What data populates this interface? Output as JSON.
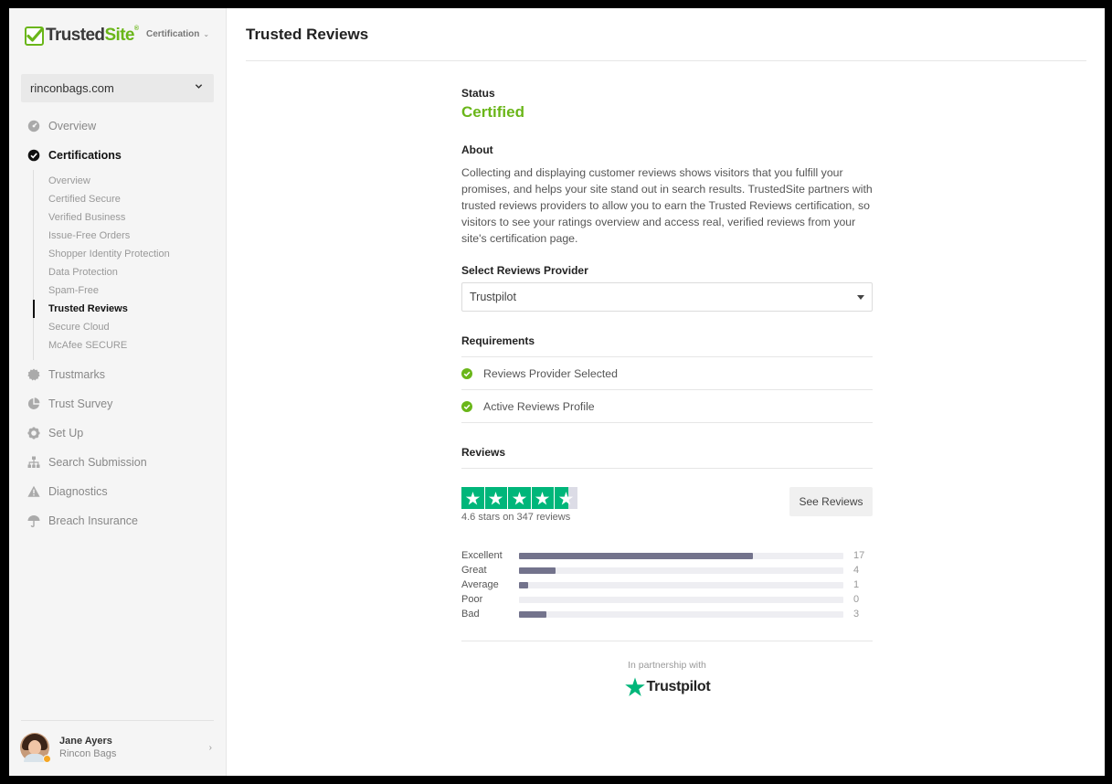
{
  "brand": {
    "name_part1": "Trusted",
    "name_part2": "Site",
    "reg": "®"
  },
  "header_switch": {
    "label": "Certification"
  },
  "site_selector": {
    "value": "rinconbags.com"
  },
  "nav": {
    "overview": "Overview",
    "certifications": "Certifications",
    "sub_items": [
      "Overview",
      "Certified Secure",
      "Verified Business",
      "Issue-Free Orders",
      "Shopper Identity Protection",
      "Data Protection",
      "Spam-Free",
      "Trusted Reviews",
      "Secure Cloud",
      "McAfee SECURE"
    ],
    "active_sub": "Trusted Reviews",
    "trustmarks": "Trustmarks",
    "trust_survey": "Trust Survey",
    "set_up": "Set Up",
    "search_submission": "Search Submission",
    "diagnostics": "Diagnostics",
    "breach_insurance": "Breach Insurance"
  },
  "user": {
    "name": "Jane Ayers",
    "company": "Rincon Bags"
  },
  "page": {
    "title": "Trusted Reviews",
    "status_label": "Status",
    "status_value": "Certified",
    "about_label": "About",
    "about_text": "Collecting and displaying customer reviews shows visitors that you fulfill your promises, and helps your site stand out in search results. TrustedSite partners with trusted reviews providers to allow you to earn the Trusted Reviews certification, so visitors to see your ratings overview and access real, verified reviews from your site's certification page.",
    "provider_label": "Select Reviews Provider",
    "provider_value": "Trustpilot",
    "requirements_label": "Requirements",
    "requirements": [
      "Reviews Provider Selected",
      "Active Reviews Profile"
    ],
    "reviews_label": "Reviews",
    "rating": 4.6,
    "rating_caption": "4.6 stars on 347 reviews",
    "see_reviews_button": "See Reviews",
    "distribution": [
      {
        "label": "Excellent",
        "count": "17",
        "fraction": 0.72
      },
      {
        "label": "Great",
        "count": "4",
        "fraction": 0.113
      },
      {
        "label": "Average",
        "count": "1",
        "fraction": 0.028
      },
      {
        "label": "Poor",
        "count": "0",
        "fraction": 0.0
      },
      {
        "label": "Bad",
        "count": "3",
        "fraction": 0.085
      }
    ],
    "partnership_text": "In partnership with",
    "partner_name": "Trustpilot"
  },
  "colors": {
    "accent_green": "#6ab619",
    "trustpilot_green": "#00b67a",
    "bar": "#73738c"
  }
}
